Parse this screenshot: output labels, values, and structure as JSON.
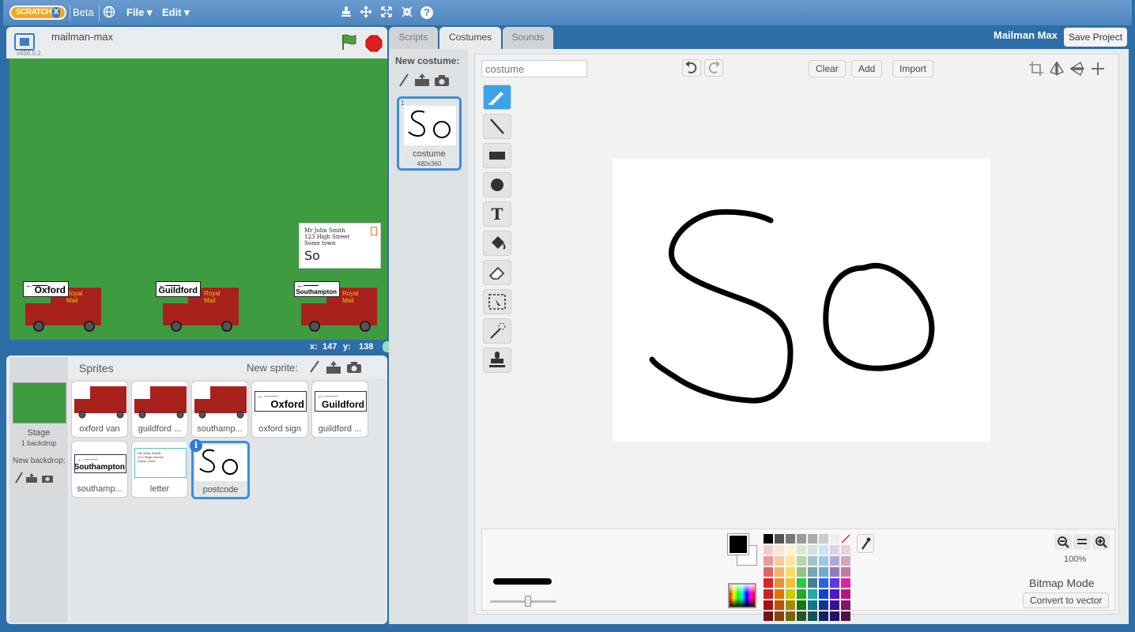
{
  "topbar": {
    "logo_text": "SCRATCH",
    "logo_badge": "X",
    "beta_label": "Beta",
    "file_menu": "File ▾",
    "edit_menu": "Edit ▾",
    "icons": [
      "globe-icon",
      "stamp-icon",
      "grow-icon",
      "expand-icon",
      "shrink-icon",
      "help-icon"
    ]
  },
  "stage": {
    "project_name": "mailman-max",
    "version": "v456.0.2",
    "coords_x_label": "x:",
    "coords_x": "147",
    "coords_y_label": "y:",
    "coords_y": "138",
    "background_color": "#3f9b40",
    "letter": {
      "line1": "Mr John Smith",
      "line2": "123 High Street",
      "line3": "Some town",
      "postcode": "So"
    },
    "vans": [
      {
        "sign": "Oxford",
        "rm1": "Royal",
        "rm2": "Mail"
      },
      {
        "sign": "Guildford",
        "rm1": "Royal",
        "rm2": "Mail"
      },
      {
        "sign": "Southampton",
        "rm1": "Royal",
        "rm2": "Mail"
      }
    ]
  },
  "sprites_panel": {
    "title": "Sprites",
    "new_sprite_label": "New sprite:",
    "stage_label": "Stage",
    "stage_sub": "1 backdrop",
    "new_backdrop_label": "New backdrop:",
    "sprites": [
      {
        "name": "oxford van",
        "kind": "van"
      },
      {
        "name": "guildford ...",
        "kind": "van"
      },
      {
        "name": "southamp...",
        "kind": "van"
      },
      {
        "name": "oxford sign",
        "kind": "sign",
        "text": "Oxford"
      },
      {
        "name": "guildford ...",
        "kind": "sign",
        "text": "Guildford"
      },
      {
        "name": "southamp...",
        "kind": "sign",
        "text": "Southampton"
      },
      {
        "name": "letter",
        "kind": "letter"
      },
      {
        "name": "postcode",
        "kind": "postcode",
        "selected": true
      }
    ]
  },
  "tabs": [
    "Scripts",
    "Costumes",
    "Sounds"
  ],
  "active_tab": "Costumes",
  "project_title": "Mailman Max",
  "save_button": "Save Project",
  "costumes": {
    "new_costume_label": "New costume:",
    "items": [
      {
        "index": "1",
        "name": "costume",
        "size": "480x360"
      }
    ]
  },
  "paint_editor": {
    "costume_name_placeholder": "costume",
    "clear": "Clear",
    "add": "Add",
    "import": "Import",
    "zoom": "100%",
    "mode_label": "Bitmap Mode",
    "convert_button": "Convert to vector",
    "primary_color": "#000000",
    "secondary_color": "#ffffff",
    "tools": [
      "brush-tool",
      "line-tool",
      "rectangle-tool",
      "ellipse-tool",
      "text-tool",
      "fill-tool",
      "eraser-tool",
      "select-tool",
      "wand-tool",
      "stamp-tool"
    ],
    "palette": [
      [
        "#000000",
        "#555555",
        "#777777",
        "#999999",
        "#aaaaaa",
        "#cccccc",
        "#eeeeee",
        "#ffffff"
      ],
      [
        "#f4cccc",
        "#fce5cd",
        "#fff2cc",
        "#d9ead3",
        "#d0e0e3",
        "#cfe2f3",
        "#d9d2e9",
        "#ead1dc"
      ],
      [
        "#ea9999",
        "#f9cb9c",
        "#ffe599",
        "#b6d7a8",
        "#a2c4c9",
        "#9fc5e8",
        "#b4a7d6",
        "#d5a6bd"
      ],
      [
        "#e06666",
        "#f6b26b",
        "#ffd966",
        "#93c47d",
        "#76a5af",
        "#6fa8dc",
        "#8e7cc3",
        "#c27ba0"
      ],
      [
        "#dd2222",
        "#e69138",
        "#f1c232",
        "#22cc44",
        "#45818e",
        "#2266ee",
        "#6633ee",
        "#dd22aa"
      ],
      [
        "#cc2222",
        "#dd7700",
        "#cccc00",
        "#22aa22",
        "#22aaaa",
        "#1144cc",
        "#5511cc",
        "#bb1188"
      ],
      [
        "#aa1111",
        "#bb5500",
        "#aa8800",
        "#117711",
        "#117788",
        "#113399",
        "#331199",
        "#881166"
      ],
      [
        "#771111",
        "#884400",
        "#776600",
        "#225522",
        "#115555",
        "#112266",
        "#221166",
        "#551144"
      ]
    ]
  }
}
